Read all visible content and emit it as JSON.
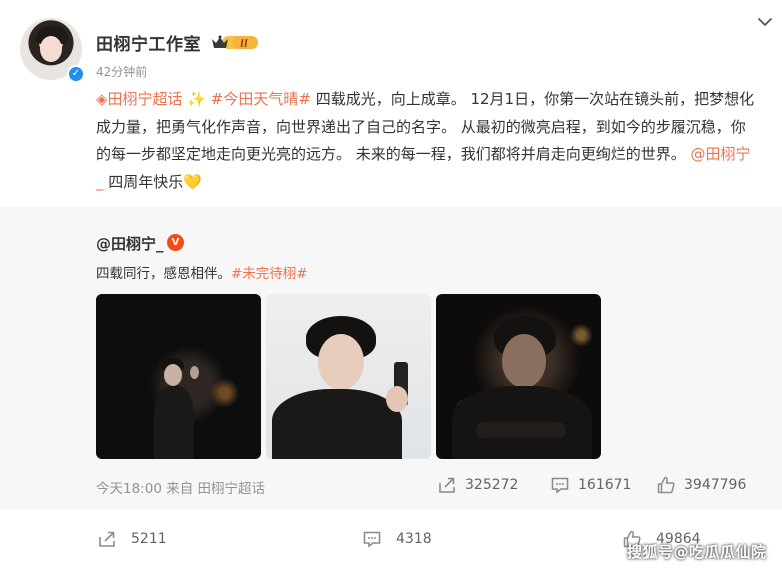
{
  "post": {
    "author": "田栩宁工作室",
    "time": "42分钟前",
    "vip_level": "II",
    "content": {
      "supertopic": "◈田栩宁超话",
      "sparkle": "✨",
      "hashtag": "#今田天气晴#",
      "body": " 四载成光，向上成章。 12月1日，你第一次站在镜头前，把梦想化成力量，把勇气化作声音，向世界递出了自己的名字。 从最初的微亮启程，到如今的步履沉稳，你的每一步都坚定地走向更光亮的远方。 未来的每一程，我们都将并肩走向更绚烂的世界。 ",
      "mention": "@田栩宁_",
      "tail": " 四周年快乐",
      "heart": "💛"
    },
    "actions": {
      "repost": "5211",
      "comment": "4318",
      "like": "49864"
    }
  },
  "repost": {
    "author": "@田栩宁_",
    "text": "四载同行，感恩相伴。",
    "hashtag": "#未完待栩#",
    "meta": "今天18:00 来自 田栩宁超话",
    "stats": {
      "repost": "325272",
      "comment": "161671",
      "like": "3947796"
    }
  },
  "watermark": "搜狐号@吃瓜瓜仙院",
  "colors": {
    "link": "#eb7350",
    "verify": "#1f8ef1",
    "repost_bg": "#f7f7f7"
  },
  "icons": [
    "more-chevron-icon",
    "verified-icon",
    "vip-crown-icon",
    "repost-icon",
    "comment-icon",
    "like-icon"
  ]
}
